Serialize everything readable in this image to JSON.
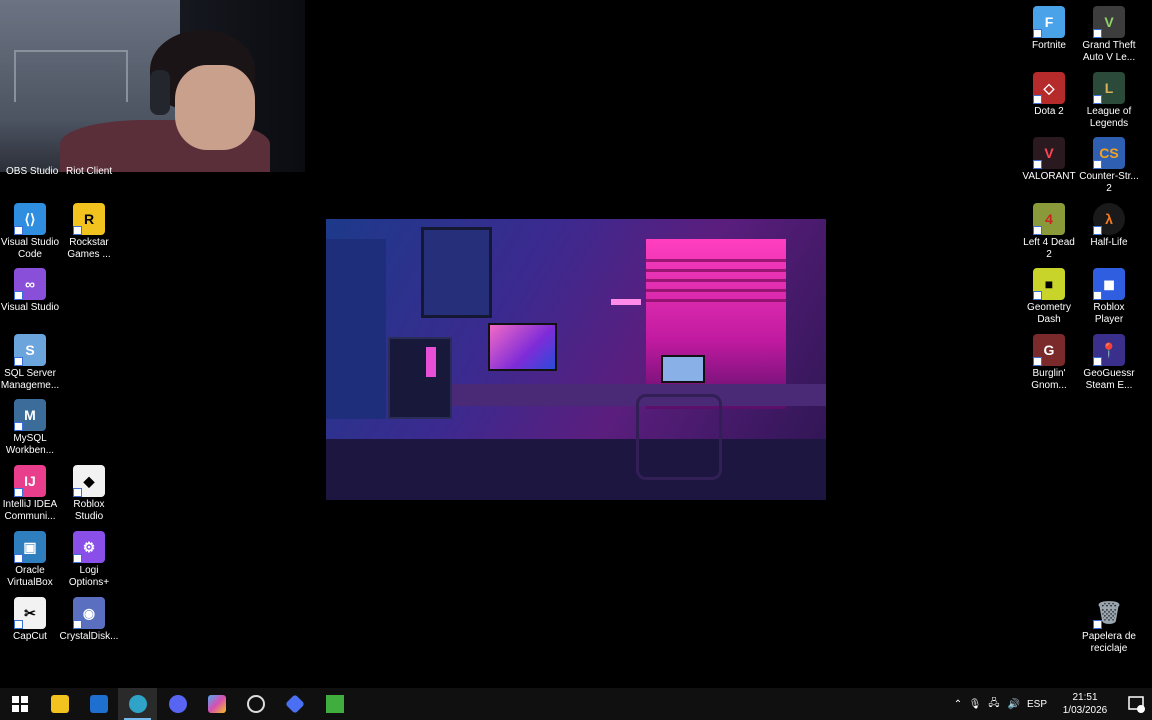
{
  "webcam": {
    "partial_labels": [
      "OBS Studio",
      "Riot Client"
    ]
  },
  "desktop_left": [
    {
      "name": "vscode",
      "label": "Visual Studio Code",
      "color": "#2f8ee0"
    },
    {
      "name": "rockstar",
      "label": "Rockstar Games ...",
      "color": "#f2c21f"
    },
    {
      "name": "visual-studio",
      "label": "Visual Studio",
      "color": "#8a4fd8"
    },
    {
      "name": "sql-server",
      "label": "SQL Server Manageme...",
      "color": "#6ca4dc"
    },
    {
      "name": "mysql",
      "label": "MySQL Workben...",
      "color": "#3c6d9a"
    },
    {
      "name": "intellij",
      "label": "IntelliJ IDEA Communi...",
      "color": "#e83e8c"
    },
    {
      "name": "roblox-studio",
      "label": "Roblox Studio",
      "color": "#f2f2f2"
    },
    {
      "name": "virtualbox",
      "label": "Oracle VirtualBox",
      "color": "#2f7fbf"
    },
    {
      "name": "logi",
      "label": "Logi Options+",
      "color": "#8a4fe8"
    },
    {
      "name": "capcut",
      "label": "CapCut",
      "color": "#f2f2f2"
    },
    {
      "name": "crystaldisk",
      "label": "CrystalDisk...",
      "color": "#5a6fbf"
    }
  ],
  "desktop_right": [
    {
      "name": "fortnite",
      "label": "Fortnite",
      "color": "#4aa3e8"
    },
    {
      "name": "gta5",
      "label": "Grand Theft Auto V Le...",
      "color": "#3d3d3d"
    },
    {
      "name": "dota2",
      "label": "Dota 2",
      "color": "#b52a2a"
    },
    {
      "name": "lol",
      "label": "League of Legends",
      "color": "#2b4a3a"
    },
    {
      "name": "valorant",
      "label": "VALORANT",
      "color": "#2a1a1f"
    },
    {
      "name": "cs2",
      "label": "Counter-Str... 2",
      "color": "#2f5fb0"
    },
    {
      "name": "l4d2",
      "label": "Left 4 Dead 2",
      "color": "#8a9a3a"
    },
    {
      "name": "half-life",
      "label": "Half-Life",
      "color": "#1a1a1a"
    },
    {
      "name": "geometry-dash",
      "label": "Geometry Dash",
      "color": "#c8d42a"
    },
    {
      "name": "roblox-player",
      "label": "Roblox Player",
      "color": "#2f5fe0"
    },
    {
      "name": "burglin-gnomes",
      "label": "Burglin' Gnom...",
      "color": "#7a2a2a"
    },
    {
      "name": "geoguessr",
      "label": "GeoGuessr Steam E...",
      "color": "#3a2f8a"
    },
    {
      "name": "recycle-bin",
      "label": "Papelera de reciclaje",
      "color": "#9aa6b0"
    }
  ],
  "taskbar": {
    "apps": [
      {
        "name": "start",
        "color": "#ffffff"
      },
      {
        "name": "file-explorer",
        "color": "#f2c21f"
      },
      {
        "name": "outlook",
        "color": "#1f6fd0"
      },
      {
        "name": "edge",
        "color": "#2fa3c8",
        "active": true
      },
      {
        "name": "discord-app",
        "color": "#5865f2"
      },
      {
        "name": "copilot",
        "color": "#d84fb0"
      },
      {
        "name": "speedtest",
        "color": "#3a3a3a"
      },
      {
        "name": "dev-tool",
        "color": "#4a6ff2"
      },
      {
        "name": "minecraft",
        "color": "#3fae3f"
      }
    ],
    "language": "ESP",
    "time": "21:51",
    "date": "1/03/2026"
  }
}
